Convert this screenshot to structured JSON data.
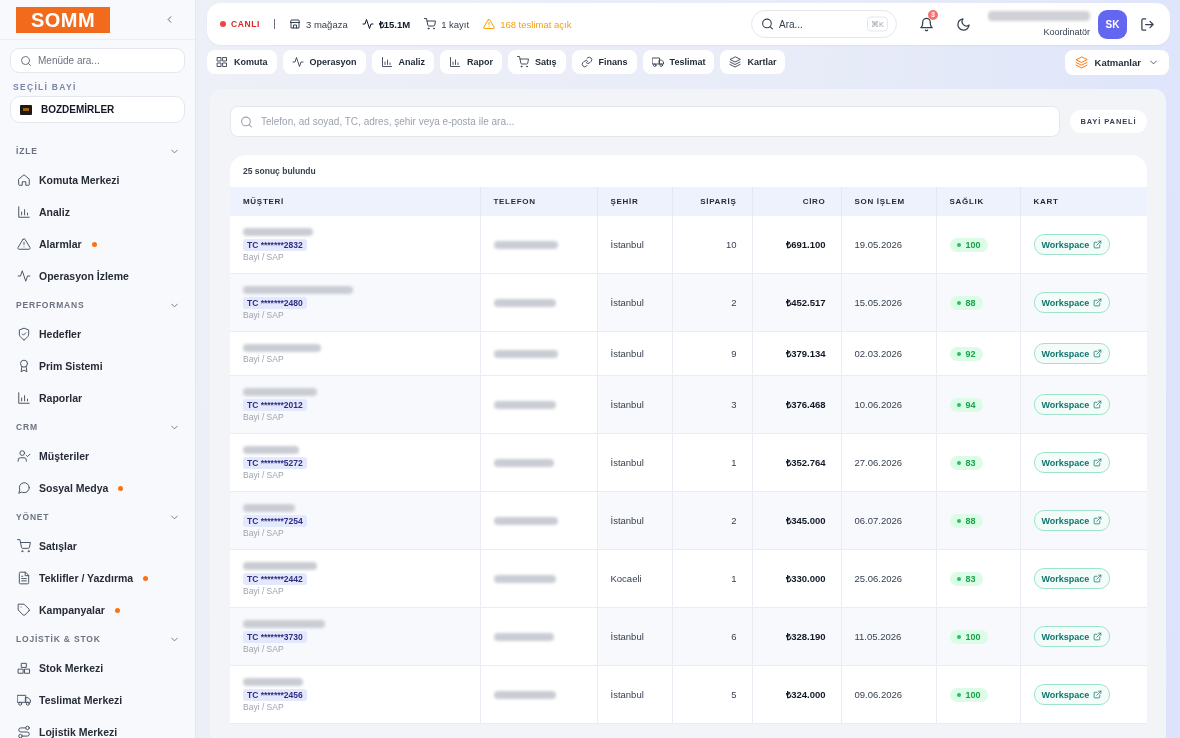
{
  "sidebar": {
    "logo": "SOMM",
    "search": {
      "placeholder": "Menüde ara..."
    },
    "dealer": {
      "label": "SEÇİLİ BAYİ",
      "name": "BOZDEMİRLER"
    },
    "sections": [
      {
        "title": "İZLE",
        "expanded": true,
        "items": [
          {
            "label": "Komuta Merkezi",
            "alert": false
          },
          {
            "label": "Analiz",
            "alert": false
          },
          {
            "label": "Alarmlar",
            "alert": true
          },
          {
            "label": "Operasyon İzleme",
            "alert": false
          }
        ]
      },
      {
        "title": "PERFORMANS",
        "expanded": true,
        "items": [
          {
            "label": "Hedefler",
            "alert": false
          },
          {
            "label": "Prim Sistemi",
            "alert": false
          },
          {
            "label": "Raporlar",
            "alert": false
          }
        ]
      },
      {
        "title": "CRM",
        "expanded": true,
        "items": [
          {
            "label": "Müşteriler",
            "alert": false
          },
          {
            "label": "Sosyal Medya",
            "alert": true
          }
        ]
      },
      {
        "title": "YÖNET",
        "expanded": true,
        "items": [
          {
            "label": "Satışlar",
            "alert": false
          },
          {
            "label": "Teklifler / Yazdırma",
            "alert": true
          },
          {
            "label": "Kampanyalar",
            "alert": true
          }
        ]
      },
      {
        "title": "LOJİSTİK & STOK",
        "expanded": true,
        "items": [
          {
            "label": "Stok Merkezi",
            "alert": false
          },
          {
            "label": "Teslimat Merkezi",
            "alert": false
          },
          {
            "label": "Lojistik Merkezi",
            "alert": false
          }
        ]
      }
    ]
  },
  "topbar": {
    "status": "CANLI",
    "stats": [
      {
        "kind": "stores",
        "text": "3 mağaza"
      },
      {
        "kind": "revenue",
        "text": "₺15.1M"
      },
      {
        "kind": "records",
        "text": "1 kayıt"
      },
      {
        "kind": "warning",
        "text": "168 teslimat açık"
      }
    ],
    "search": {
      "placeholder": "Ara...",
      "shortcut": "⌘K"
    },
    "notification_count": "3",
    "user": {
      "role": "Koordinatör",
      "initials": "SK"
    }
  },
  "nav_tabs": [
    {
      "label": "Komuta"
    },
    {
      "label": "Operasyon"
    },
    {
      "label": "Analiz"
    },
    {
      "label": "Rapor"
    },
    {
      "label": "Satış"
    },
    {
      "label": "Finans"
    },
    {
      "label": "Teslimat"
    },
    {
      "label": "Kartlar"
    }
  ],
  "layers_menu": "Katmanlar",
  "customers": {
    "search": {
      "placeholder": "Telefon, ad soyad, TC, adres, şehir veya e-posta ile ara..."
    },
    "dealer_panel_button": "BAYİ PANELİ",
    "result_count": "25 sonuç bulundu",
    "columns": [
      "MÜŞTERİ",
      "TELEFON",
      "ŞEHİR",
      "SİPARİŞ",
      "CİRO",
      "SON İŞLEM",
      "SAĞLIK",
      "KART"
    ],
    "rows": [
      {
        "tc": "TC *******2832",
        "source": "Bayi / SAP",
        "city": "İstanbul",
        "orders": "10",
        "revenue": "₺691.100",
        "last_transaction": "19.05.2026",
        "health": "100",
        "card": "Workspace"
      },
      {
        "tc": "TC *******2480",
        "source": "Bayi / SAP",
        "city": "İstanbul",
        "orders": "2",
        "revenue": "₺452.517",
        "last_transaction": "15.05.2026",
        "health": "88",
        "card": "Workspace"
      },
      {
        "source": "Bayi / SAP",
        "city": "İstanbul",
        "orders": "9",
        "revenue": "₺379.134",
        "last_transaction": "02.03.2026",
        "health": "92",
        "card": "Workspace"
      },
      {
        "tc": "TC *******2012",
        "source": "Bayi / SAP",
        "city": "İstanbul",
        "orders": "3",
        "revenue": "₺376.468",
        "last_transaction": "10.06.2026",
        "health": "94",
        "card": "Workspace"
      },
      {
        "tc": "TC *******5272",
        "source": "Bayi / SAP",
        "city": "İstanbul",
        "orders": "1",
        "revenue": "₺352.764",
        "last_transaction": "27.06.2026",
        "health": "83",
        "card": "Workspace"
      },
      {
        "tc": "TC *******7254",
        "source": "Bayi / SAP",
        "city": "İstanbul",
        "orders": "2",
        "revenue": "₺345.000",
        "last_transaction": "06.07.2026",
        "health": "88",
        "card": "Workspace"
      },
      {
        "tc": "TC *******2442",
        "source": "Bayi / SAP",
        "city": "Kocaeli",
        "orders": "1",
        "revenue": "₺330.000",
        "last_transaction": "25.06.2026",
        "health": "83",
        "card": "Workspace"
      },
      {
        "tc": "TC *******3730",
        "source": "Bayi / SAP",
        "city": "İstanbul",
        "orders": "6",
        "revenue": "₺328.190",
        "last_transaction": "11.05.2026",
        "health": "100",
        "card": "Workspace"
      },
      {
        "tc": "TC *******2456",
        "source": "Bayi / SAP",
        "city": "İstanbul",
        "orders": "5",
        "revenue": "₺324.000",
        "last_transaction": "09.06.2026",
        "health": "100",
        "card": "Workspace"
      }
    ]
  }
}
